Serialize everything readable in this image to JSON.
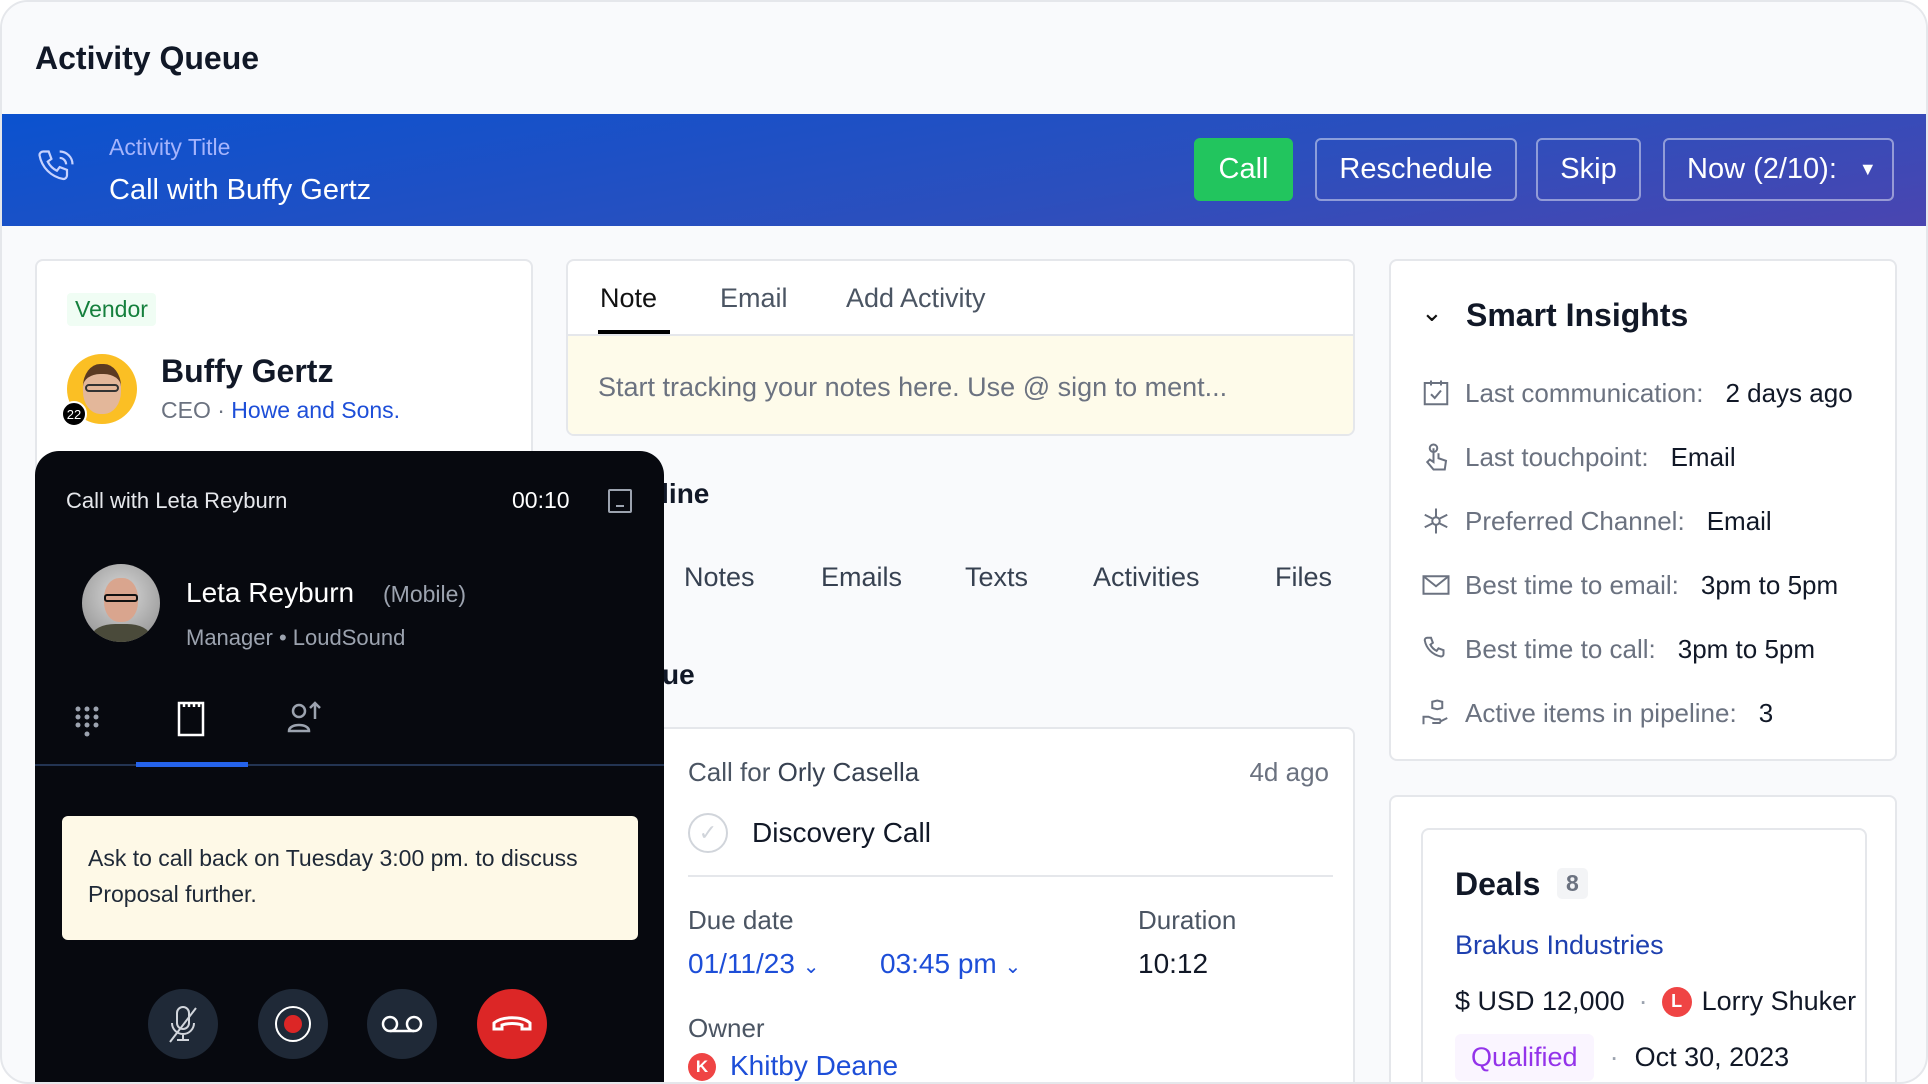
{
  "page": {
    "title": "Activity Queue"
  },
  "banner": {
    "icon": "phone-ringing-icon",
    "label": "Activity Title",
    "title": "Call with Buffy Gertz",
    "buttons": {
      "call": "Call",
      "reschedule": "Reschedule",
      "skip": "Skip",
      "queue": "Now (2/10):"
    },
    "colors": {
      "call": "#22c55e",
      "gradient_start": "#0b52cf",
      "gradient_end": "#4a45b0"
    }
  },
  "contact": {
    "badge": "Vendor",
    "name": "Buffy Gertz",
    "avatar_count": "22",
    "role": "CEO",
    "company": "Howe and Sons."
  },
  "note": {
    "tabs": [
      "Note",
      "Email",
      "Add Activity"
    ],
    "active_tab": "Note",
    "placeholder": "Start tracking your notes here. Use @ sign to ment..."
  },
  "pipeline": {
    "heading": "Pipeline",
    "tabs": [
      "Notes",
      "Emails",
      "Texts",
      "Activities",
      "Files"
    ],
    "section_heading": "ue"
  },
  "activity": {
    "prefix": "Call for",
    "person": "Orly Casella",
    "time_ago": "4d ago",
    "title": "Discovery Call",
    "due_label": "Due date",
    "due_date": "01/11/23",
    "due_time": "03:45 pm",
    "duration_label": "Duration",
    "duration": "10:12",
    "owner_label": "Owner",
    "owner_initial": "K",
    "owner": "Khitby Deane"
  },
  "call_widget": {
    "title": "Call with Leta Reyburn",
    "timer": "00:10",
    "name": "Leta Reyburn",
    "phone_type": "(Mobile)",
    "role": "Manager",
    "company": "LoudSound",
    "tabs": [
      "dialpad-icon",
      "notes-icon",
      "transfer-icon"
    ],
    "active_tab": "notes-icon",
    "note": "Ask to call back on Tuesday 3:00 pm. to discuss Proposal further.",
    "controls": [
      "mute-icon",
      "record-icon",
      "voicemail-icon",
      "hangup-icon"
    ],
    "colors": {
      "hangup": "#dc2626",
      "record": "#dc2626",
      "tab_active": "#2563eb"
    }
  },
  "insights": {
    "heading": "Smart Insights",
    "rows": [
      {
        "icon": "calendar-check-icon",
        "label": "Last communication:",
        "value": "2 days ago"
      },
      {
        "icon": "touch-icon",
        "label": "Last touchpoint:",
        "value": "Email"
      },
      {
        "icon": "network-icon",
        "label": "Preferred Channel:",
        "value": "Email"
      },
      {
        "icon": "mail-icon",
        "label": "Best time to email:",
        "value": "3pm to 5pm"
      },
      {
        "icon": "phone-icon",
        "label": "Best time to call:",
        "value": "3pm to 5pm"
      },
      {
        "icon": "hand-box-icon",
        "label": "Active items in pipeline:",
        "value": "3"
      }
    ]
  },
  "deals": {
    "heading": "Deals",
    "count": "8",
    "company": "Brakus Industries",
    "amount": "$ USD 12,000",
    "owner_initial": "L",
    "owner": "Lorry Shuker",
    "stage": "Qualified",
    "date": "Oct 30, 2023"
  }
}
